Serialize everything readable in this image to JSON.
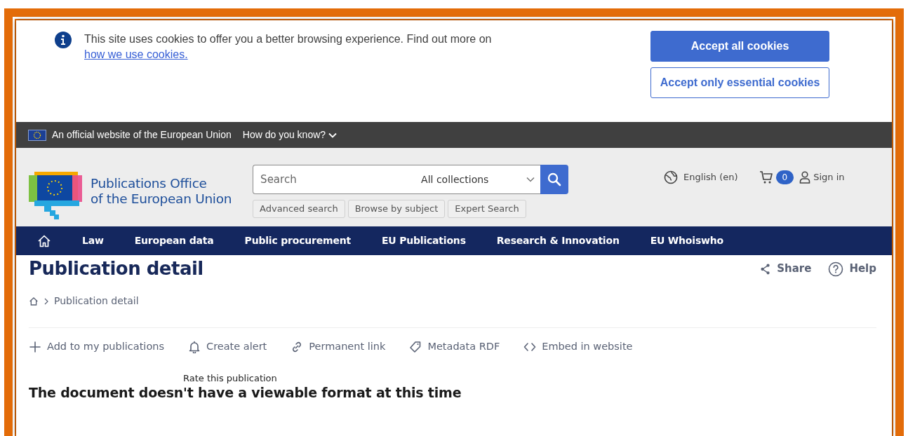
{
  "cookie_banner": {
    "message": "This site uses cookies to offer you a better browsing experience. Find out more on",
    "link": "how we use cookies.",
    "buttons": [
      {
        "label": "Accept all cookies",
        "kind": "primary"
      },
      {
        "label": "Accept only essential cookies",
        "kind": "outline"
      }
    ]
  },
  "official_bar": {
    "text": "An official website of the European Union",
    "toggle": "How do you know?"
  },
  "header": {
    "logo_lines": [
      "Publications Office",
      "of the European Union"
    ],
    "search": {
      "placeholder": "Search",
      "collection": "All collections"
    },
    "quick_links": [
      "Advanced search",
      "Browse by subject",
      "Expert Search"
    ],
    "language": "English (en)",
    "cart_count": "0",
    "sign_in": "Sign in"
  },
  "nav": {
    "items": [
      "Law",
      "European data",
      "Public procurement",
      "EU Publications",
      "Research & Innovation",
      "EU Whoiswho"
    ]
  },
  "page": {
    "title": "Publication detail",
    "actions": [
      {
        "label": "Share",
        "kind": "share"
      },
      {
        "label": "Help",
        "kind": "help"
      }
    ],
    "breadcrumb": [
      "Publication detail"
    ],
    "tools": [
      {
        "label": "Add to my publications",
        "kind": "add"
      },
      {
        "label": "Create alert",
        "kind": "alert"
      },
      {
        "label": "Permanent link",
        "kind": "link"
      },
      {
        "label": "Metadata RDF",
        "kind": "metadata"
      },
      {
        "label": "Embed in website",
        "kind": "embed"
      }
    ],
    "rating_label": "Rate this publication",
    "notice": "The document doesn't have a viewable format at this time"
  }
}
